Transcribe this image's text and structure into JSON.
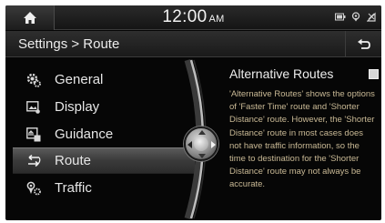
{
  "status_bar": {
    "time": "12:00",
    "ampm": "AM"
  },
  "header": {
    "title": "Settings > Route"
  },
  "menu": {
    "items": [
      {
        "label": "General",
        "icon": "gear-icon",
        "selected": false
      },
      {
        "label": "Display",
        "icon": "display-icon",
        "selected": false
      },
      {
        "label": "Guidance",
        "icon": "guidance-icon",
        "selected": false
      },
      {
        "label": "Route",
        "icon": "route-icon",
        "selected": true
      },
      {
        "label": "Traffic",
        "icon": "traffic-icon",
        "selected": false
      }
    ]
  },
  "option": {
    "title": "Alternative Routes",
    "checked": false,
    "description": "'Alternative Routes' shows the options of 'Faster Time' route and 'Shorter Distance' route. However, the 'Shorter Distance' route in most cases does not have traffic information, so the time to destination for the 'Shorter Distance' route may not always be accurate."
  },
  "colors": {
    "background": "#060606",
    "description_text": "#c9b995",
    "selected_row": "#4a4a4a"
  }
}
